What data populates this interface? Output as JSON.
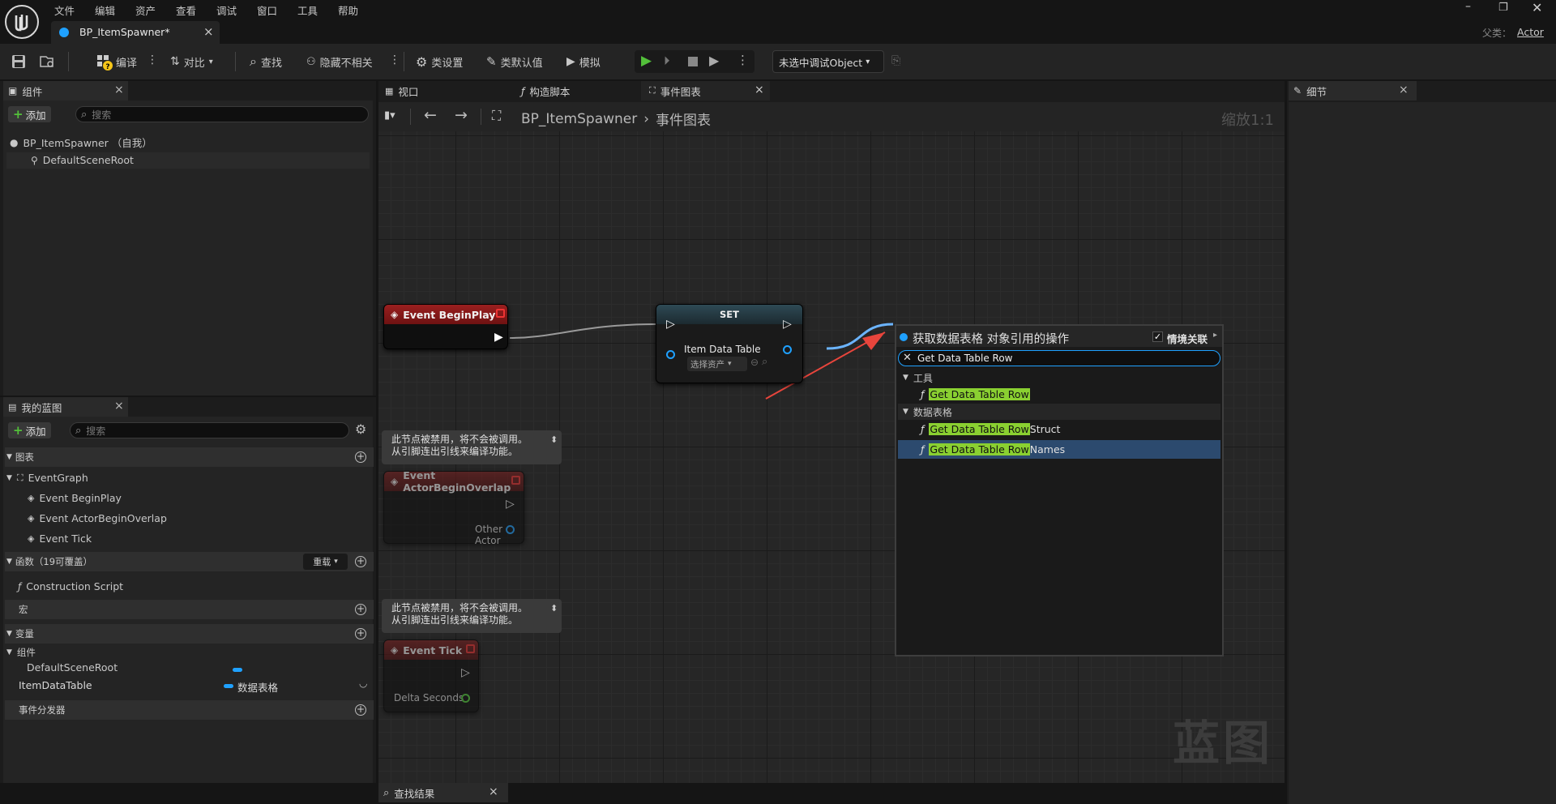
{
  "menu": [
    "文件",
    "编辑",
    "资产",
    "查看",
    "调试",
    "窗口",
    "工具",
    "帮助"
  ],
  "doc_tab": {
    "label": "BP_ItemSpawner*"
  },
  "parent_class": {
    "label": "父类：",
    "value": "Actor"
  },
  "toolbar": {
    "compile": "编译",
    "diff": "对比",
    "find": "查找",
    "hide_unrelated": "隐藏不相关",
    "class_settings": "类设置",
    "class_defaults": "类默认值",
    "simulate": "模拟",
    "debug_object": "未选中调试Object"
  },
  "components_panel": {
    "title": "组件",
    "add": "添加",
    "search_placeholder": "搜索",
    "root": "BP_ItemSpawner （自我）",
    "child": "DefaultSceneRoot"
  },
  "my_blueprint": {
    "title": "我的蓝图",
    "add": "添加",
    "search_placeholder": "搜索",
    "graphs_header": "图表",
    "event_graph": "EventGraph",
    "events": [
      "Event BeginPlay",
      "Event ActorBeginOverlap",
      "Event Tick"
    ],
    "functions_header": "函数（19可覆盖）",
    "override": "重载",
    "construction_script": "Construction Script",
    "macros_header": "宏",
    "variables_header": "变量",
    "components_group": "组件",
    "var_default_scene_root": "DefaultSceneRoot",
    "var_item_data_table": "ItemDataTable",
    "var_item_data_table_type": "数据表格",
    "dispatchers_header": "事件分发器"
  },
  "editor_tabs": {
    "viewport": "视口",
    "construction": "构造脚本",
    "event_graph": "事件图表"
  },
  "breadcrumb": {
    "blueprint": "BP_ItemSpawner",
    "graph": "事件图表",
    "zoom": "缩放1:1"
  },
  "details": {
    "title": "细节"
  },
  "graph": {
    "begin_play": "Event BeginPlay",
    "set_node": {
      "title": "SET",
      "var": "Item Data Table",
      "asset_select": "选择资产"
    },
    "disabled_comment_1": "此节点被禁用，将不会被调用。\n从引脚连出引线来编译功能。",
    "disabled_comment_2": "此节点被禁用，将不会被调用。\n从引脚连出引线来编译功能。",
    "overlap_node": {
      "title": "Event ActorBeginOverlap",
      "pin": "Other Actor"
    },
    "tick_node": {
      "title": "Event Tick",
      "pin": "Delta Seconds"
    },
    "watermark": "蓝图"
  },
  "action_menu": {
    "title": "获取数据表格 对象引用的操作",
    "context_label": "情境关联",
    "context_checked": true,
    "search_value": "Get Data Table Row",
    "cat_tools": "工具",
    "cat_data_table": "数据表格",
    "results": [
      {
        "match": "Get Data Table Row",
        "suffix": ""
      },
      {
        "match": "Get Data Table Row",
        "suffix": "Struct"
      },
      {
        "match": "Get Data Table Row",
        "suffix": "Names"
      }
    ]
  },
  "find_results": {
    "title": "查找结果"
  },
  "colors": {
    "accent": "#1fa1ff",
    "highlight": "#8ad031",
    "event_red": "#8c1a1a",
    "play_green": "#53c03a",
    "annotation_arrow": "#e8453c"
  }
}
